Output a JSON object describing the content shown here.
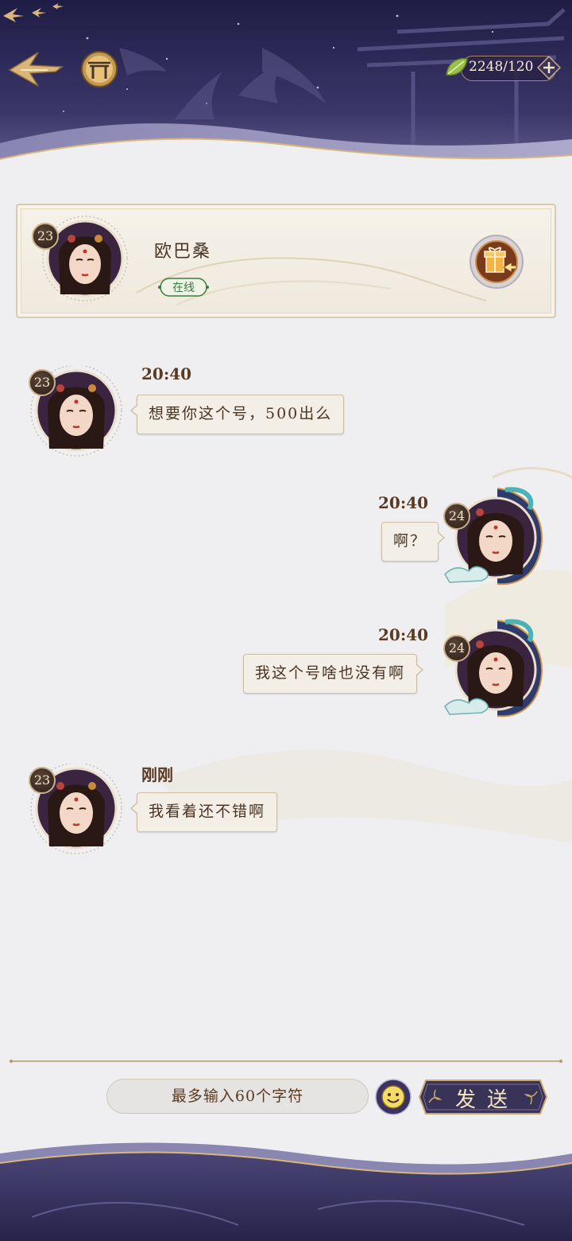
{
  "header": {
    "back_icon": "arrow-back-icon",
    "home_icon": "gate-home-icon",
    "currency": {
      "icon": "leaf-icon",
      "value": "2248/120",
      "plus_icon": "plus-icon"
    }
  },
  "contact": {
    "name": "欧巴桑",
    "level": "23",
    "status": "在线",
    "gift_icon": "gift-send-icon"
  },
  "messages": [
    {
      "side": "left",
      "level": "23",
      "time": "20:40",
      "text": "想要你这个号，500出么"
    },
    {
      "side": "right",
      "level": "24",
      "time": "20:40",
      "text": "啊？"
    },
    {
      "side": "right",
      "level": "24",
      "time": "20:40",
      "text": "我这个号啥也没有啊"
    },
    {
      "side": "left",
      "level": "23",
      "time": "刚刚",
      "text": "我看着还不错啊"
    }
  ],
  "composer": {
    "placeholder": "最多输入60个字符",
    "emoji_icon": "smiley-icon",
    "send_label": "发送"
  },
  "colors": {
    "banner_dark": "#2b2650",
    "gold": "#d9b77a",
    "text_brown": "#5a3a22",
    "online_green": "#3f7a3e"
  }
}
